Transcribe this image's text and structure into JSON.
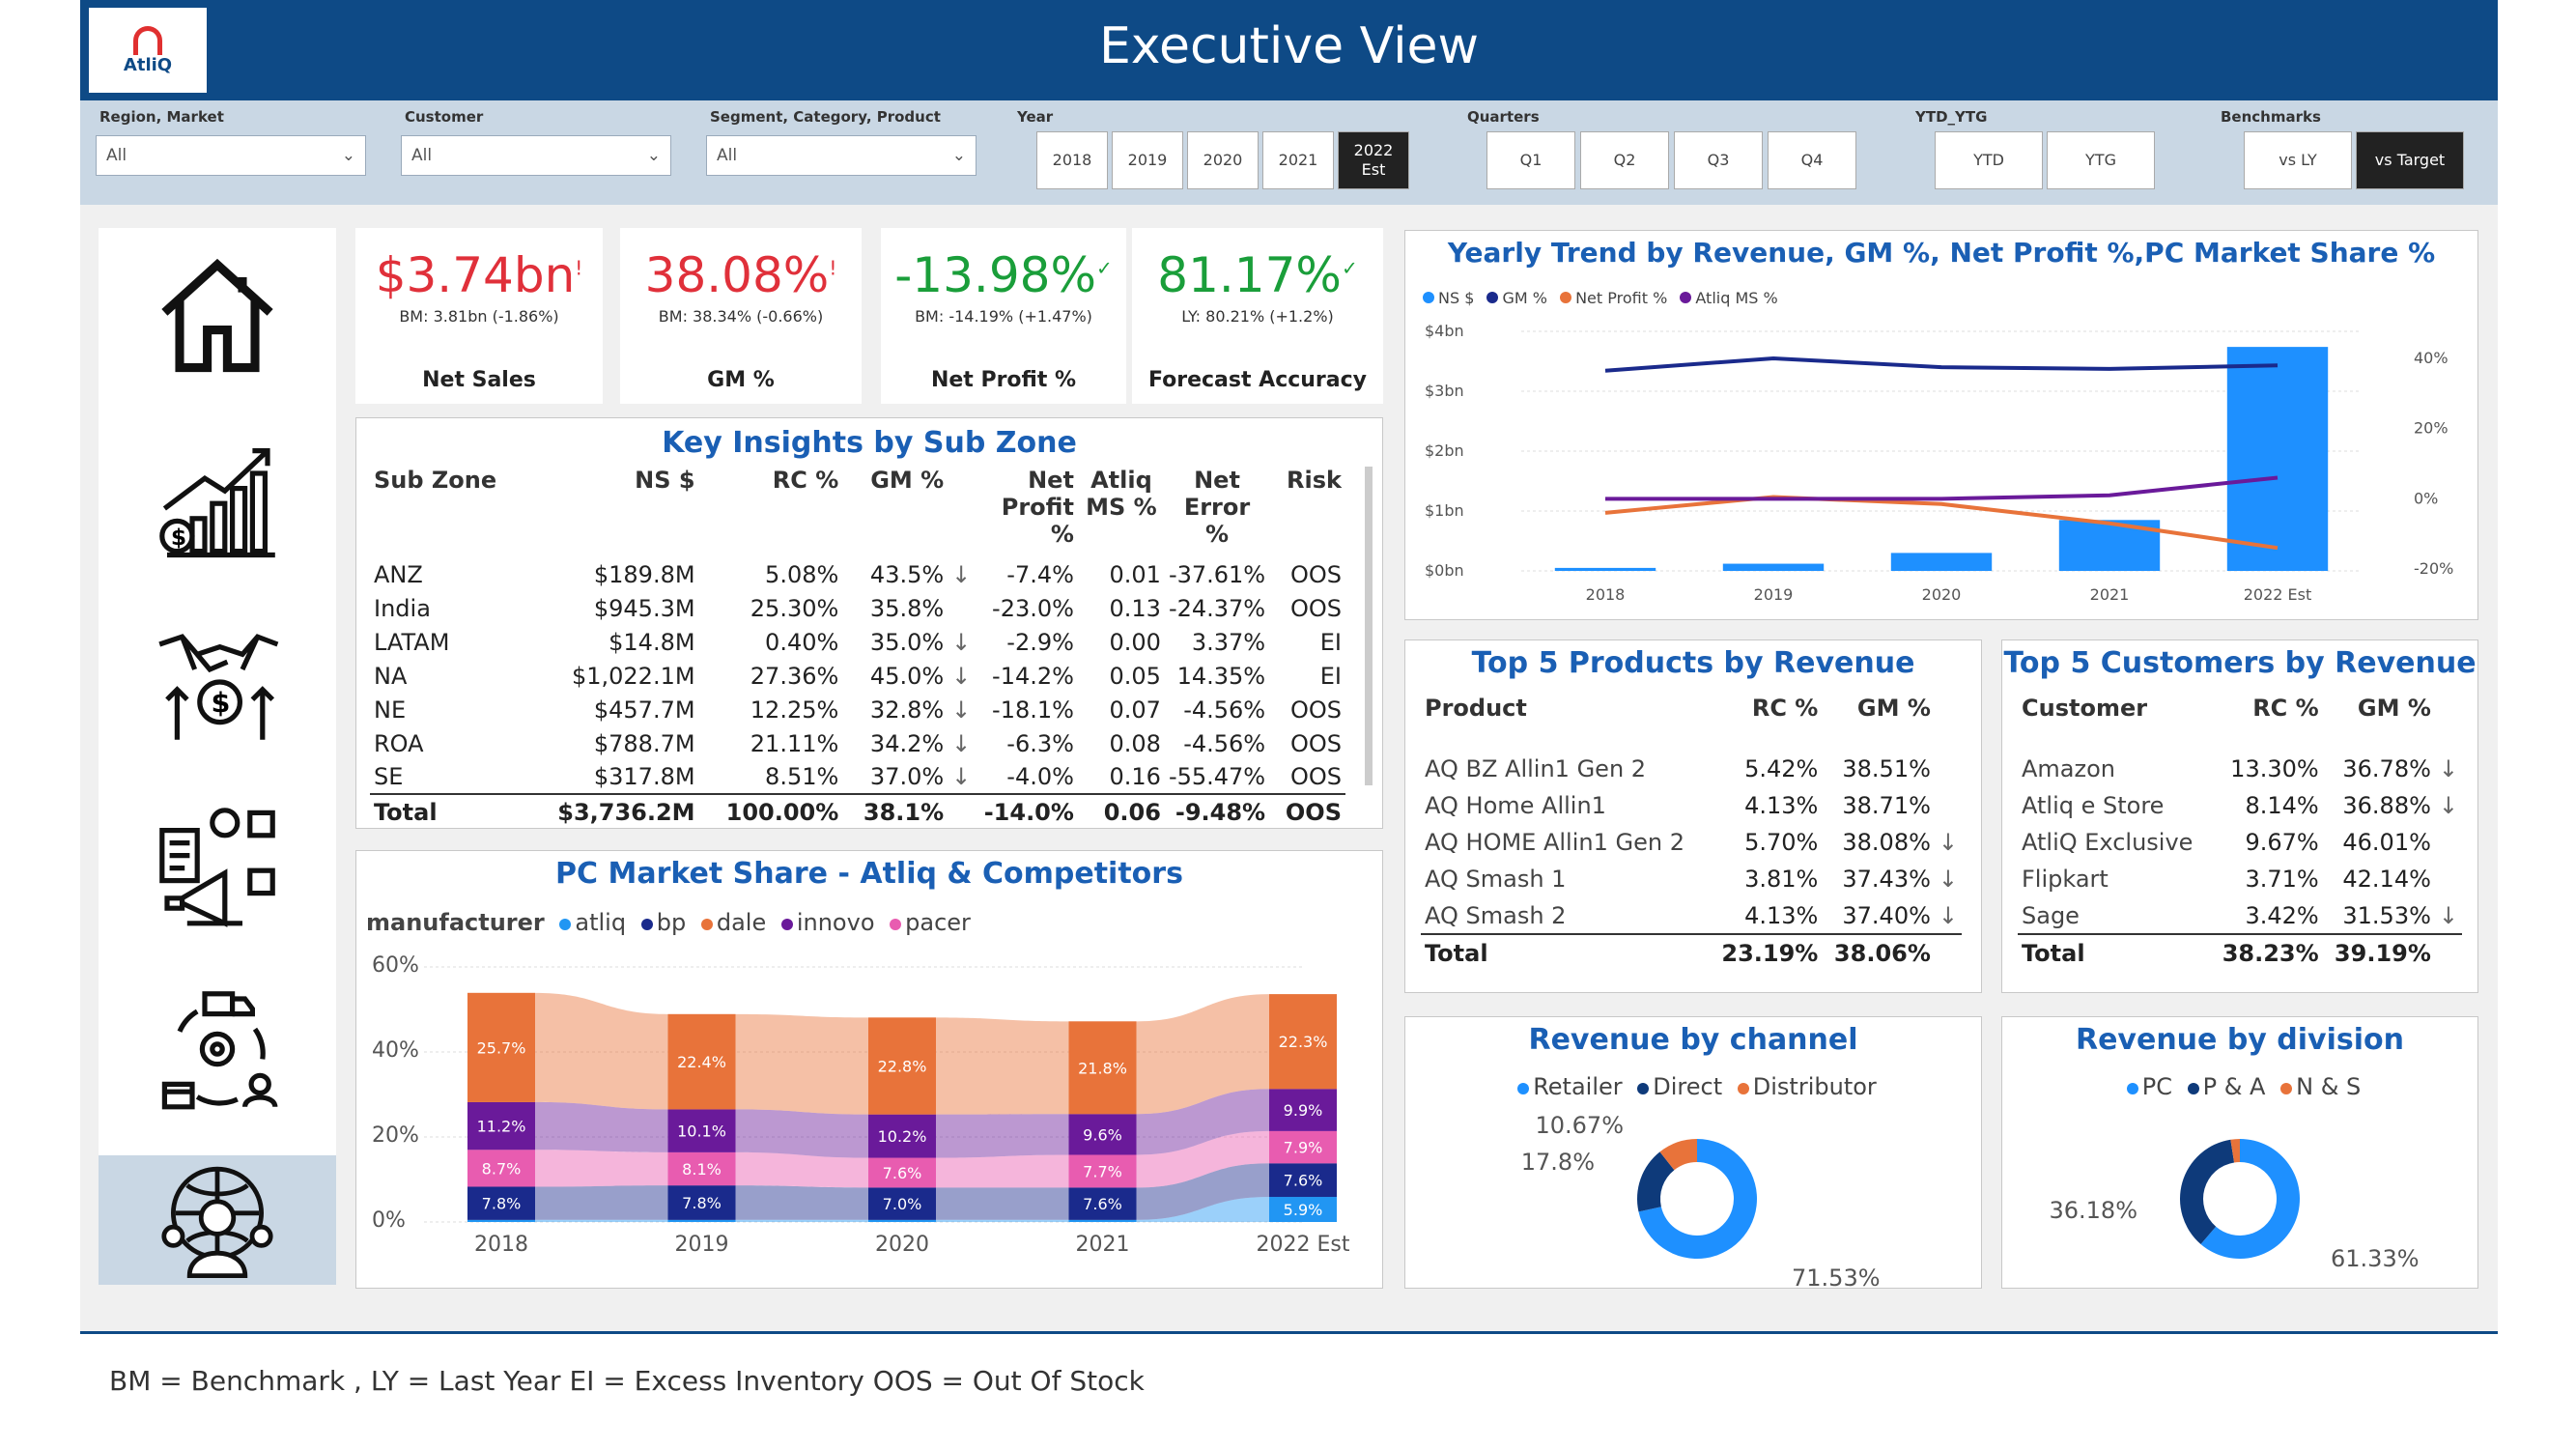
{
  "header": {
    "title": "Executive View",
    "logo_text": "AtliQ"
  },
  "filters": {
    "region": {
      "label": "Region, Market",
      "value": "All"
    },
    "customer": {
      "label": "Customer",
      "value": "All"
    },
    "segment": {
      "label": "Segment, Category, Product",
      "value": "All"
    },
    "year": {
      "label": "Year",
      "options": [
        "2018",
        "2019",
        "2020",
        "2021",
        "2022 Est"
      ],
      "selected": "2022 Est"
    },
    "quarters": {
      "label": "Quarters",
      "options": [
        "Q1",
        "Q2",
        "Q3",
        "Q4"
      ]
    },
    "ytd": {
      "label": "YTD_YTG",
      "options": [
        "YTD",
        "YTG"
      ]
    },
    "benchmarks": {
      "label": "Benchmarks",
      "options": [
        "vs LY",
        "vs Target"
      ],
      "selected": "vs Target"
    }
  },
  "nav": [
    "home-icon",
    "growth-chart-icon",
    "finance-handshake-icon",
    "marketing-icon",
    "supply-chain-icon",
    "executive-icon"
  ],
  "kpis": [
    {
      "value": "$3.74bn",
      "mark": "!",
      "sub": "BM: 3.81bn (-1.86%)",
      "label": "Net Sales",
      "status": "red"
    },
    {
      "value": "38.08%",
      "mark": "!",
      "sub": "BM: 38.34% (-0.66%)",
      "label": "GM %",
      "status": "red"
    },
    {
      "value": "-13.98%",
      "mark": "✓",
      "sub": "BM: -14.19% (+1.47%)",
      "label": "Net Profit %",
      "status": "green"
    },
    {
      "value": "81.17%",
      "mark": "✓",
      "sub": "LY: 80.21% (+1.2%)",
      "label": "Forecast Accuracy",
      "status": "green"
    }
  ],
  "subzone": {
    "title": "Key Insights by Sub Zone",
    "headers": [
      "Sub Zone",
      "NS $",
      "RC %",
      "GM %",
      "Net Profit %",
      "Atliq MS %",
      "Net Error %",
      "Risk"
    ],
    "rows": [
      [
        "ANZ",
        "$189.8M",
        "5.08%",
        "43.5%",
        "↓",
        "-7.4%",
        "0.01",
        "-37.61%",
        "OOS"
      ],
      [
        "India",
        "$945.3M",
        "25.30%",
        "35.8%",
        "",
        "-23.0%",
        "0.13",
        "-24.37%",
        "OOS"
      ],
      [
        "LATAM",
        "$14.8M",
        "0.40%",
        "35.0%",
        "↓",
        "-2.9%",
        "0.00",
        "3.37%",
        "EI"
      ],
      [
        "NA",
        "$1,022.1M",
        "27.36%",
        "45.0%",
        "↓",
        "-14.2%",
        "0.05",
        "14.35%",
        "EI"
      ],
      [
        "NE",
        "$457.7M",
        "12.25%",
        "32.8%",
        "↓",
        "-18.1%",
        "0.07",
        "-4.56%",
        "OOS"
      ],
      [
        "ROA",
        "$788.7M",
        "21.11%",
        "34.2%",
        "↓",
        "-6.3%",
        "0.08",
        "-4.56%",
        "OOS"
      ],
      [
        "SE",
        "$317.8M",
        "8.51%",
        "37.0%",
        "↓",
        "-4.0%",
        "0.16",
        "-55.47%",
        "OOS"
      ]
    ],
    "total": [
      "Total",
      "$3,736.2M",
      "100.00%",
      "38.1%",
      "",
      "-14.0%",
      "0.06",
      "-9.48%",
      "OOS"
    ]
  },
  "products": {
    "title": "Top 5 Products by Revenue",
    "headers": [
      "Product",
      "RC %",
      "GM %"
    ],
    "rows": [
      [
        "AQ BZ Allin1 Gen 2",
        "5.42%",
        "38.51%",
        ""
      ],
      [
        "AQ Home Allin1",
        "4.13%",
        "38.71%",
        ""
      ],
      [
        "AQ HOME Allin1 Gen 2",
        "5.70%",
        "38.08%",
        "↓"
      ],
      [
        "AQ Smash 1",
        "3.81%",
        "37.43%",
        "↓"
      ],
      [
        "AQ Smash 2",
        "4.13%",
        "37.40%",
        "↓"
      ]
    ],
    "total": [
      "Total",
      "23.19%",
      "38.06%"
    ]
  },
  "customers": {
    "title": "Top 5 Customers by Revenue",
    "headers": [
      "Customer",
      "RC %",
      "GM %"
    ],
    "rows": [
      [
        "Amazon",
        "13.30%",
        "36.78%",
        "↓"
      ],
      [
        "Atliq e Store",
        "8.14%",
        "36.88%",
        "↓"
      ],
      [
        "AtliQ Exclusive",
        "9.67%",
        "46.01%",
        ""
      ],
      [
        "Flipkart",
        "3.71%",
        "42.14%",
        ""
      ],
      [
        "Sage",
        "3.42%",
        "31.53%",
        "↓"
      ]
    ],
    "total": [
      "Total",
      "38.23%",
      "39.19%"
    ]
  },
  "footer": "BM = Benchmark , LY = Last Year EI = Excess Inventory OOS = Out Of Stock",
  "chart_data": [
    {
      "type": "bar",
      "title": "Yearly Trend by Revenue, GM %, Net Profit %,PC Market Share %",
      "legend": [
        "NS $",
        "GM %",
        "Net Profit %",
        "Atliq MS %"
      ],
      "colors": [
        "#1e90ff",
        "#1a2a8c",
        "#e8733a",
        "#6a1a9a"
      ],
      "categories": [
        "2018",
        "2019",
        "2020",
        "2021",
        "2022 Est"
      ],
      "y_ticks": [
        "$0bn",
        "$1bn",
        "$2bn",
        "$3bn",
        "$4bn"
      ],
      "y2_ticks": [
        "-20%",
        "0%",
        "20%",
        "40%"
      ],
      "series": [
        {
          "name": "NS $",
          "type": "bar",
          "values": [
            0.05,
            0.12,
            0.3,
            0.85,
            3.74
          ]
        },
        {
          "name": "GM %",
          "type": "line",
          "values": [
            36.5,
            40,
            37.5,
            37,
            38
          ]
        },
        {
          "name": "Net Profit %",
          "type": "line",
          "values": [
            -4,
            0.5,
            -1.5,
            -7,
            -14
          ]
        },
        {
          "name": "Atliq MS %",
          "type": "line",
          "values": [
            0,
            0,
            0,
            1,
            6
          ]
        }
      ]
    },
    {
      "type": "area",
      "title": "PC Market Share - Atliq & Competitors",
      "legend_title": "manufacturer",
      "legend": [
        "atliq",
        "bp",
        "dale",
        "innovo",
        "pacer"
      ],
      "categories": [
        "2018",
        "2019",
        "2020",
        "2021",
        "2022 Est"
      ],
      "y_ticks": [
        "0%",
        "20%",
        "40%",
        "60%"
      ],
      "series": [
        {
          "name": "atliq",
          "color": "#2196f3",
          "values": [
            0.5,
            0.5,
            0.5,
            0.5,
            5.9
          ]
        },
        {
          "name": "bp",
          "color": "#1a2a8c",
          "values": [
            7.8,
            8.1,
            7.6,
            7.6,
            7.9
          ]
        },
        {
          "name": "pacer",
          "color": "#e85cb0",
          "values": [
            8.7,
            7.8,
            7.0,
            7.7,
            7.6
          ]
        },
        {
          "name": "innovo",
          "color": "#6a1a9a",
          "values": [
            11.2,
            10.1,
            10.2,
            9.6,
            9.9
          ]
        },
        {
          "name": "dale",
          "color": "#e8733a",
          "values": [
            25.7,
            22.4,
            22.8,
            21.8,
            22.3
          ]
        }
      ],
      "labels": [
        [
          "7.8%",
          "8.7%",
          "11.2%",
          "25.7%"
        ],
        [
          "7.8%",
          "8.1%",
          "10.1%",
          "22.4%"
        ],
        [
          "7.0%",
          "7.6%",
          "10.2%",
          "22.8%"
        ],
        [
          "7.6%",
          "7.7%",
          "9.6%",
          "21.8%"
        ],
        [
          "5.9%",
          "7.6%",
          "7.9%",
          "9.9%",
          "22.3%"
        ]
      ]
    },
    {
      "type": "pie",
      "title": "Revenue by channel",
      "legend": [
        "Retailer",
        "Direct",
        "Distributor"
      ],
      "values": [
        71.53,
        17.8,
        10.67
      ],
      "labels": [
        "71.53%",
        "17.8%",
        "10.67%"
      ],
      "colors": [
        "#1e90ff",
        "#0e3a7a",
        "#e8733a"
      ]
    },
    {
      "type": "pie",
      "title": "Revenue by division",
      "legend": [
        "PC",
        "P & A",
        "N & S"
      ],
      "values": [
        61.33,
        36.18,
        2.49
      ],
      "labels": [
        "61.33%",
        "36.18%"
      ],
      "colors": [
        "#1e90ff",
        "#0e3a7a",
        "#e8733a"
      ]
    }
  ]
}
